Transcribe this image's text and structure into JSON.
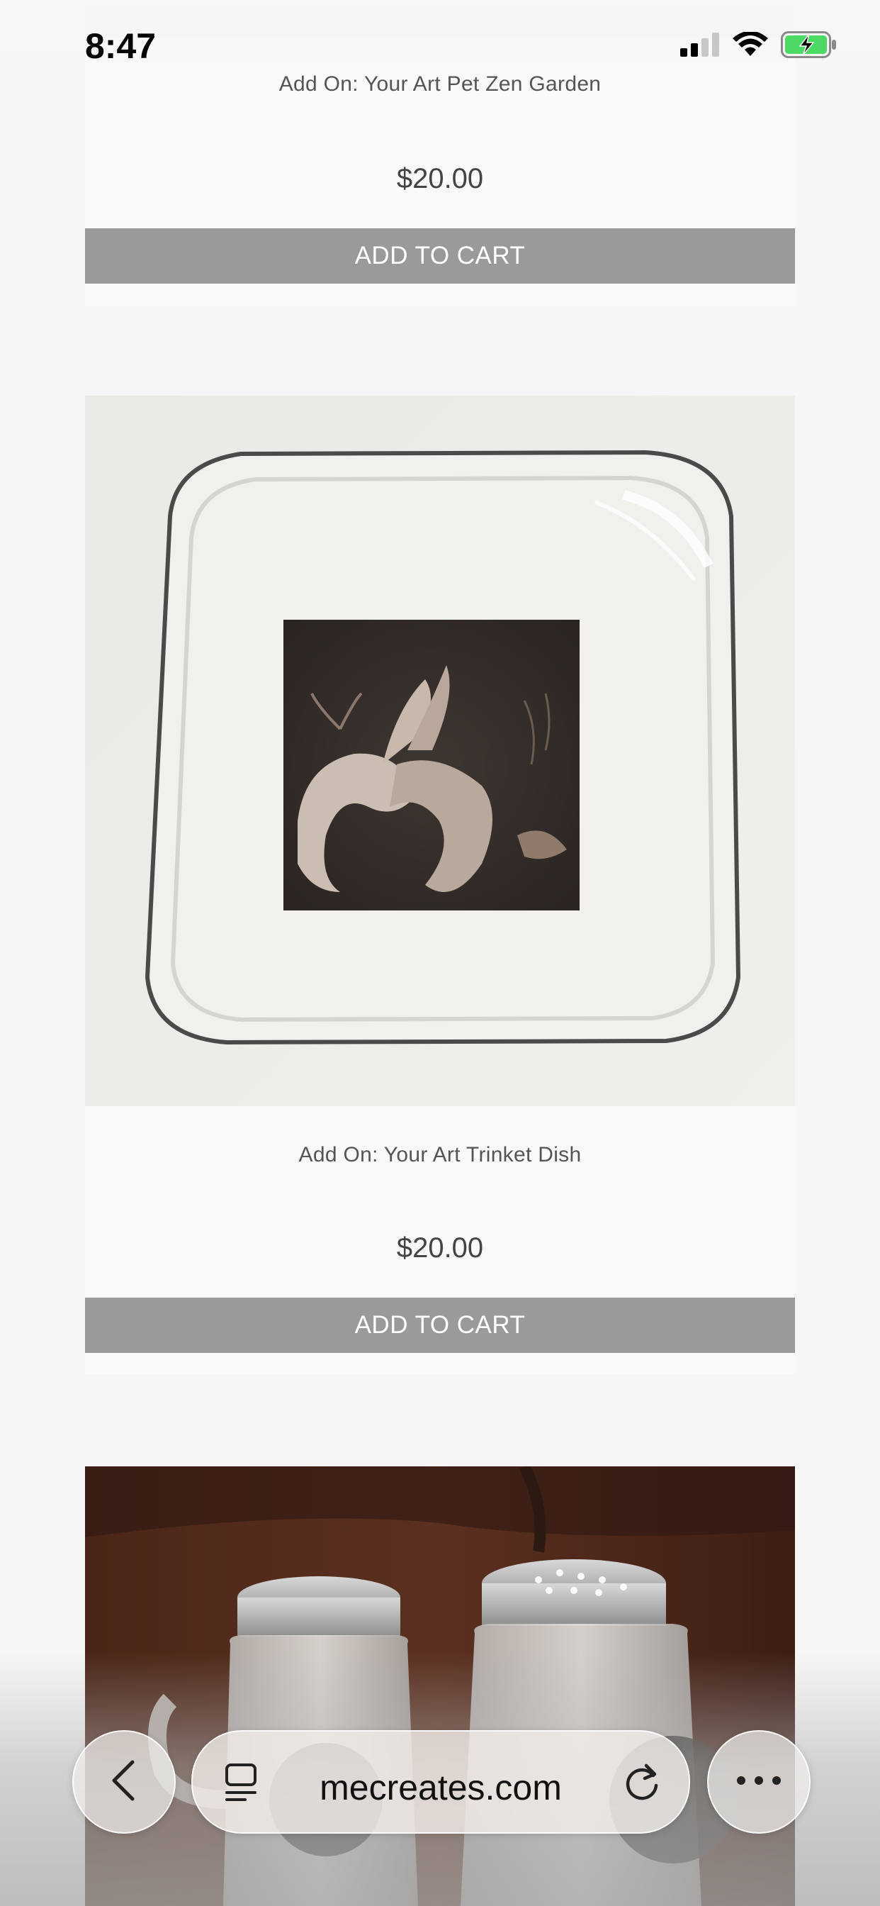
{
  "status_bar": {
    "time": "8:47"
  },
  "products": [
    {
      "title": "Add On: Your Art Pet Zen Garden",
      "price": "$20.00",
      "button_label": "ADD TO CART"
    },
    {
      "title": "Add On: Your Art Trinket Dish",
      "price": "$20.00",
      "button_label": "ADD TO CART"
    }
  ],
  "browser": {
    "url": "mecreates.com",
    "icons": {
      "back": "chevron-left-icon",
      "tabs": "tab-overview-icon",
      "reload": "reload-icon",
      "more": "more-icon"
    }
  }
}
